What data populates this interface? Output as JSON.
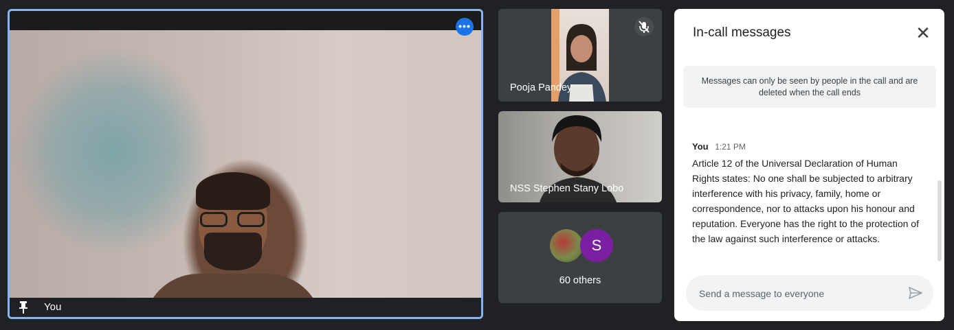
{
  "main_tile": {
    "name": "You",
    "more_options_icon": "more-horiz-icon",
    "pin_icon": "pin-icon"
  },
  "participants": [
    {
      "name": "Pooja Pandey",
      "muted": true
    },
    {
      "name": "NSS Stephen Stany Lobo",
      "muted": false
    }
  ],
  "others": {
    "avatar_letter": "S",
    "avatar_color": "#7b1fa2",
    "label": "60 others"
  },
  "chat": {
    "title": "In-call messages",
    "notice": "Messages can only be seen by people in the call and are deleted when the call ends",
    "messages": [
      {
        "sender": "You",
        "time": "1:21 PM",
        "text": "Article 12 of the Universal Declaration of Human Rights states: No one shall be subjected to arbitrary interference with his privacy, family, home or correspondence, nor to attacks upon his honour and reputation. Everyone has the right to the protection of the law against such interference or attacks."
      }
    ],
    "input_placeholder": "Send a message to everyone"
  },
  "colors": {
    "accent": "#1a73e8",
    "active_border": "#8ab4f8",
    "background": "#202124",
    "tile": "#3c4043"
  }
}
